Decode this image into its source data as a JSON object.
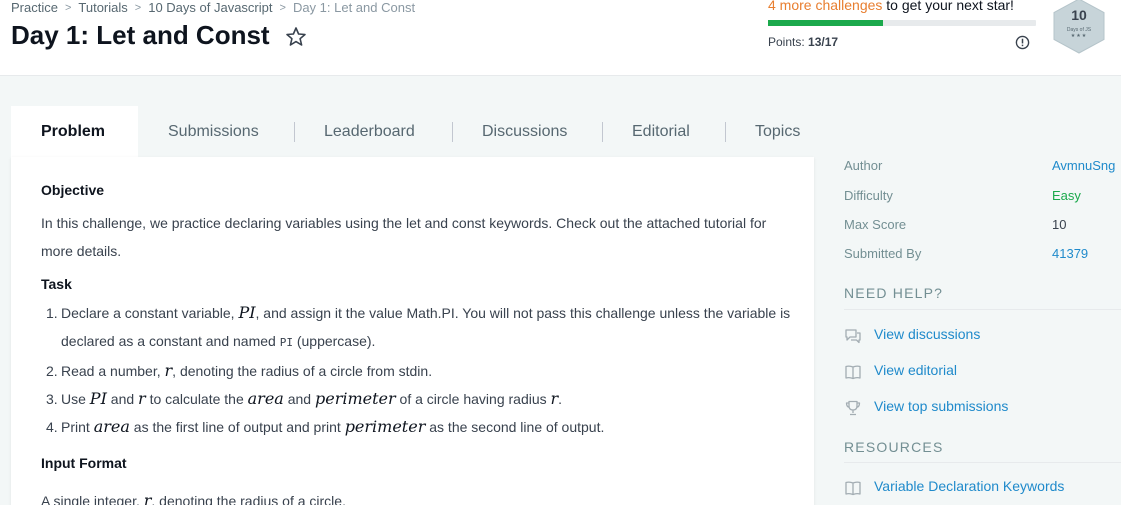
{
  "breadcrumb": [
    "Practice",
    "Tutorials",
    "10 Days of Javascript",
    "Day 1: Let and Const"
  ],
  "header": {
    "title": "Day 1: Let and Const",
    "challenges_accent": "4 more challenges",
    "challenges_rest": " to get your next star!",
    "progress_fraction": 0.43,
    "points_label": "Points: ",
    "points_value": "13/17",
    "badge_number": "10",
    "badge_subtitle": "Days of JS",
    "badge_stars": "★★★"
  },
  "tabs": [
    "Problem",
    "Submissions",
    "Leaderboard",
    "Discussions",
    "Editorial",
    "Topics"
  ],
  "problem": {
    "objective_heading": "Objective",
    "objective_text": "In this challenge, we practice declaring variables using the let and const keywords. Check out the attached tutorial for more details.",
    "task_heading": "Task",
    "task_items": [
      {
        "num": "1.",
        "t1": "Declare a constant variable, ",
        "m1": "PI",
        "t2": ", and assign it the value Math.PI. You will not pass this challenge unless the variable is declared as a constant and named ",
        "code": "PI",
        "t3": " (uppercase)."
      },
      {
        "num": "2.",
        "t1": "Read a number, ",
        "m1": "r",
        "t2": ", denoting the radius of a circle from stdin."
      },
      {
        "num": "3.",
        "t1": "Use ",
        "m1": "PI",
        "t2": " and ",
        "m2": "r",
        "t3": " to calculate the ",
        "m3": "area",
        "t4": " and ",
        "m4": "perimeter",
        "t5": " of a circle having radius ",
        "m5": "r",
        "t6": "."
      },
      {
        "num": "4.",
        "t1": "Print ",
        "m1": "area",
        "t2": " as the first line of output and print ",
        "m2": "perimeter",
        "t3": " as the second line of output."
      }
    ],
    "input_heading": "Input Format",
    "input_t1": "A single integer, ",
    "input_m1": "r",
    "input_t2": ", denoting the radius of a circle."
  },
  "sidebar": {
    "meta": [
      {
        "label": "Author",
        "value": "AvmnuSng"
      },
      {
        "label": "Difficulty",
        "value": "Easy"
      },
      {
        "label": "Max Score",
        "value": "10"
      },
      {
        "label": "Submitted By",
        "value": "41379"
      }
    ],
    "need_help_heading": "NEED HELP?",
    "help_links": [
      "View discussions",
      "View editorial",
      "View top submissions"
    ],
    "resources_heading": "RESOURCES",
    "resources": [
      "Variable Declaration Keywords"
    ]
  },
  "colors": {
    "accent_orange": "#e87e2f",
    "progress_green": "#1ba94c",
    "link_blue": "#1f8acb",
    "easy_green": "#1ba94c"
  }
}
